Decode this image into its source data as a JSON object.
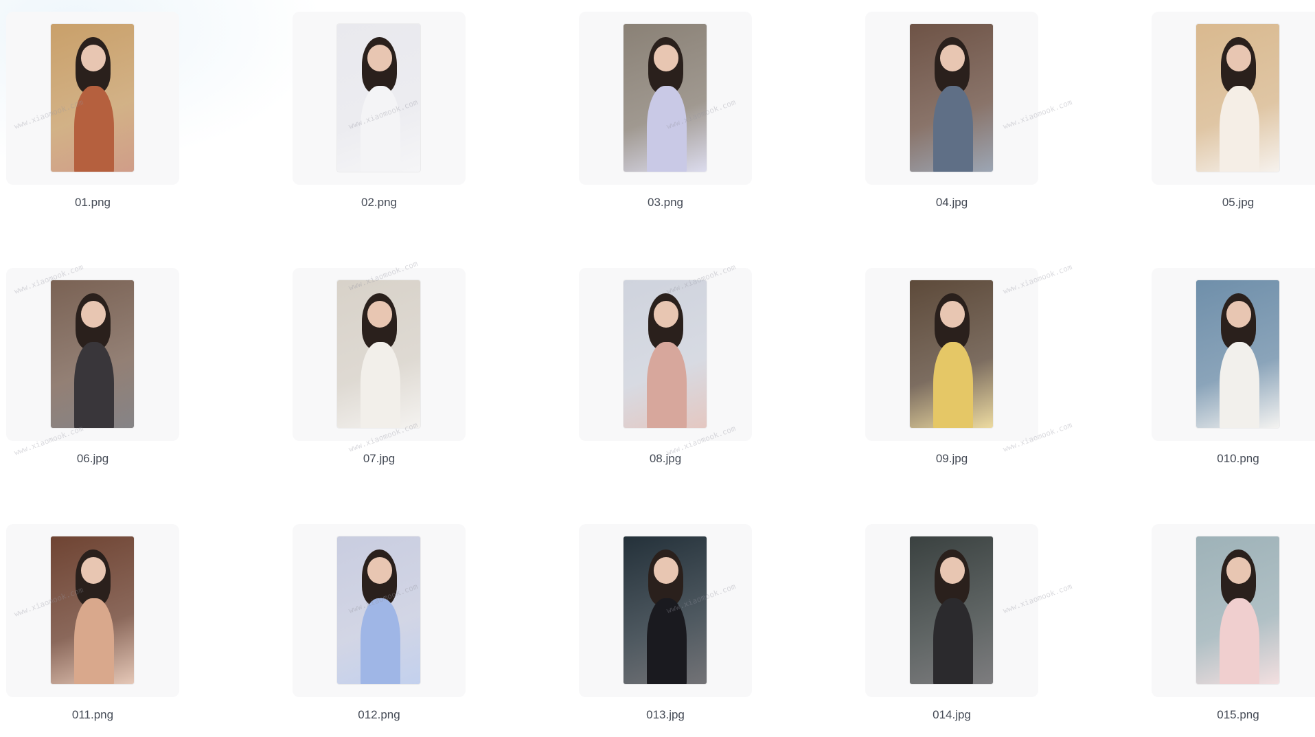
{
  "watermark": "www.xiaomook.com",
  "files": [
    {
      "name": "01.png",
      "palette": {
        "bg": "#c9a06a",
        "body": "#b5603e"
      }
    },
    {
      "name": "02.png",
      "palette": {
        "bg": "#e9e9ee",
        "body": "#f4f4f6"
      }
    },
    {
      "name": "03.png",
      "palette": {
        "bg": "#8a8176",
        "body": "#c9c9e6"
      }
    },
    {
      "name": "04.jpg",
      "palette": {
        "bg": "#6e5346",
        "body": "#5f6f86"
      }
    },
    {
      "name": "05.jpg",
      "palette": {
        "bg": "#d9b98f",
        "body": "#f5eee6"
      }
    },
    {
      "name": "06.jpg",
      "palette": {
        "bg": "#7a6254",
        "body": "#39363a"
      }
    },
    {
      "name": "07.jpg",
      "palette": {
        "bg": "#d8d2c9",
        "body": "#f2efea"
      }
    },
    {
      "name": "08.jpg",
      "palette": {
        "bg": "#cfd3dd",
        "body": "#d7a79c"
      }
    },
    {
      "name": "09.jpg",
      "palette": {
        "bg": "#5d4a3a",
        "body": "#e5c766"
      }
    },
    {
      "name": "010.png",
      "palette": {
        "bg": "#6f8faa",
        "body": "#f2f0ec"
      }
    },
    {
      "name": "011.png",
      "palette": {
        "bg": "#6f4433",
        "body": "#d9a88c"
      }
    },
    {
      "name": "012.png",
      "palette": {
        "bg": "#c9cde0",
        "body": "#9fb6e6"
      }
    },
    {
      "name": "013.jpg",
      "palette": {
        "bg": "#24313a",
        "body": "#1a1a1f"
      }
    },
    {
      "name": "014.jpg",
      "palette": {
        "bg": "#3a4140",
        "body": "#2b2a2d"
      }
    },
    {
      "name": "015.png",
      "palette": {
        "bg": "#9eb2b8",
        "body": "#f0cfcf"
      }
    }
  ]
}
